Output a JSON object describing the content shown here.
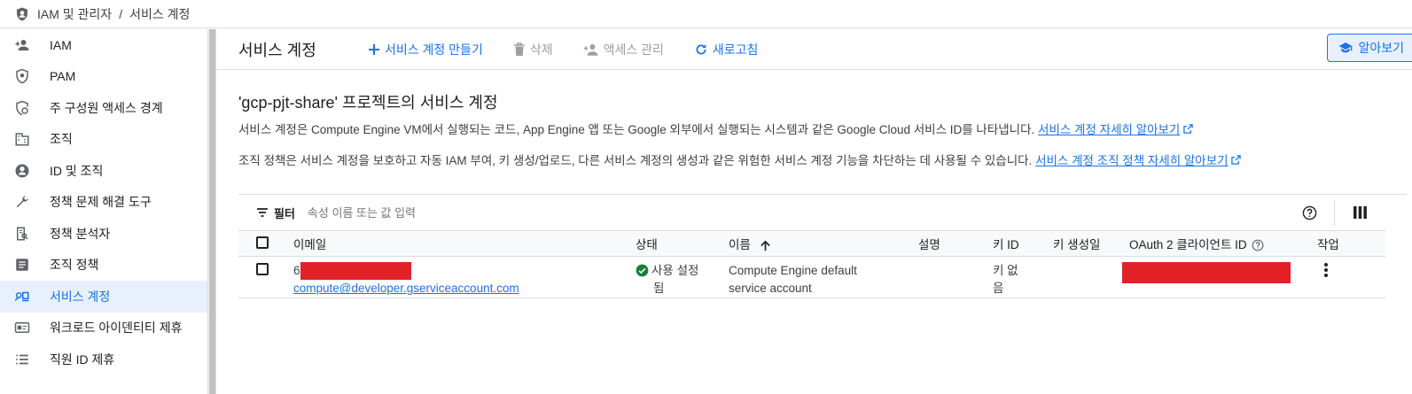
{
  "breadcrumb": {
    "section": "IAM 및 관리자",
    "separator": "/",
    "page": "서비스 계정"
  },
  "sidebar": {
    "items": [
      {
        "label": "IAM",
        "icon": "person-add-icon"
      },
      {
        "label": "PAM",
        "icon": "shield-icon"
      },
      {
        "label": "주 구성원 액세스 경계",
        "icon": "boundary-icon"
      },
      {
        "label": "조직",
        "icon": "building-icon"
      },
      {
        "label": "ID 및 조직",
        "icon": "account-circle-icon"
      },
      {
        "label": "정책 문제 해결 도구",
        "icon": "wrench-icon"
      },
      {
        "label": "정책 분석자",
        "icon": "analyzer-icon"
      },
      {
        "label": "조직 정책",
        "icon": "list-doc-icon"
      },
      {
        "label": "서비스 계정",
        "icon": "service-account-icon",
        "active": true
      },
      {
        "label": "워크로드 아이덴티티 제휴",
        "icon": "id-card-icon"
      },
      {
        "label": "직원 ID 제휴",
        "icon": "list-icon"
      }
    ]
  },
  "toolbar": {
    "title": "서비스 계정",
    "create_label": "서비스 계정 만들기",
    "delete_label": "삭제",
    "manage_access_label": "액세스 관리",
    "refresh_label": "새로고침",
    "learn_label": "알아보기"
  },
  "content": {
    "heading": "'gcp-pjt-share' 프로젝트의 서비스 계정",
    "desc1": "서비스 계정은 Compute Engine VM에서 실행되는 코드, App Engine 앱 또는 Google 외부에서 실행되는 시스템과 같은 Google Cloud 서비스 ID를 나타냅니다.",
    "desc1_link": "서비스 계정 자세히 알아보기",
    "desc2": "조직 정책은 서비스 계정을 보호하고 자동 IAM 부여, 키 생성/업로드, 다른 서비스 계정의 생성과 같은 위험한 서비스 계정 기능을 차단하는 데 사용될 수 있습니다.",
    "desc2_link": "서비스 계정 조직 정책 자세히 알아보기"
  },
  "filter": {
    "label": "필터",
    "placeholder": "속성 이름 또는 값 입력"
  },
  "table": {
    "headers": {
      "email": "이메일",
      "status": "상태",
      "name": "이름",
      "description": "설명",
      "key_id": "키 ID",
      "key_created": "키 생성일",
      "oauth": "OAuth 2 클라이언트 ID",
      "actions": "작업"
    },
    "rows": [
      {
        "email_prefix": "6",
        "email_redacted": "████████████",
        "email_suffix": "compute@developer.gserviceaccount.com",
        "status_line1": "사용 설정",
        "status_line2": "됨",
        "name_line1": "Compute Engine default",
        "name_line2": "service account",
        "description": "",
        "key_line1": "키 없",
        "key_line2": "음",
        "key_created": "",
        "oauth_redacted": "█████████████████████"
      }
    ]
  },
  "colors": {
    "accent": "#1a73e8",
    "success": "#188038",
    "redaction": "#e32228"
  }
}
